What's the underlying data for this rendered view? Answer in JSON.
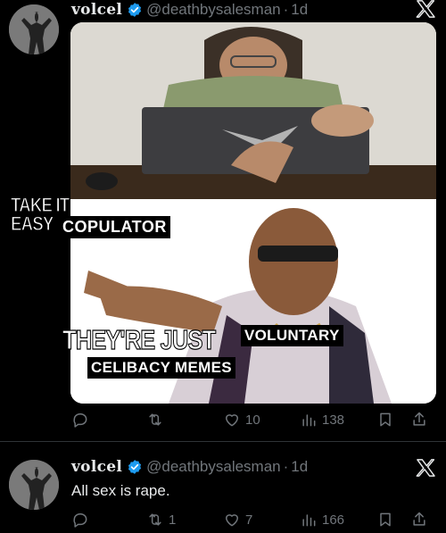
{
  "colors": {
    "background": "#000000",
    "text": "#e7e9ea",
    "muted": "#71767b",
    "verified": "#1d9bf0",
    "divider": "#2f3336"
  },
  "tweets": [
    {
      "display_name": "volcel",
      "handle": "@deathbysalesman",
      "separator": "·",
      "time": "1d",
      "media": {
        "captions": {
          "take_it_easy": "TAKE IT EASY",
          "copulator": "COPULATOR",
          "theyre_just": "THEY'RE JUST",
          "voluntary": "VOLUNTARY",
          "celibacy_memes": "CELIBACY MEMES"
        }
      },
      "actions": {
        "reply": {
          "icon": "reply-icon",
          "count": ""
        },
        "retweet": {
          "icon": "retweet-icon",
          "count": ""
        },
        "like": {
          "icon": "heart-icon",
          "count": "10"
        },
        "views": {
          "icon": "views-icon",
          "count": "138"
        },
        "bookmark": {
          "icon": "bookmark-icon"
        },
        "share": {
          "icon": "share-icon"
        }
      }
    },
    {
      "display_name": "volcel",
      "handle": "@deathbysalesman",
      "separator": "·",
      "time": "1d",
      "text": "All sex is rape.",
      "actions": {
        "reply": {
          "icon": "reply-icon",
          "count": ""
        },
        "retweet": {
          "icon": "retweet-icon",
          "count": "1"
        },
        "like": {
          "icon": "heart-icon",
          "count": "7"
        },
        "views": {
          "icon": "views-icon",
          "count": "166"
        },
        "bookmark": {
          "icon": "bookmark-icon"
        },
        "share": {
          "icon": "share-icon"
        }
      }
    }
  ]
}
